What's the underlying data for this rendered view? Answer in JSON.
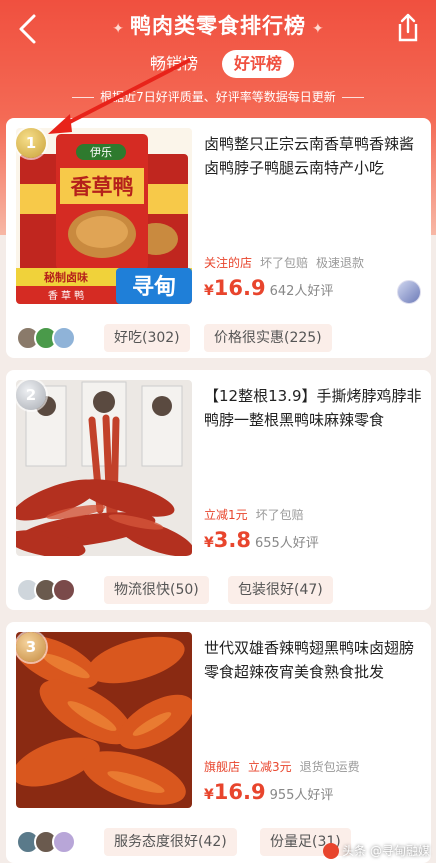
{
  "header": {
    "title": "鸭肉类零食排行榜",
    "tabs": [
      "畅销榜",
      "好评榜"
    ],
    "active_tab": "好评榜",
    "subtitle": "根据近7日好评质量、好评率等数据每日更新"
  },
  "products": [
    {
      "rank": "1",
      "title": "卤鸭整只正宗云南香草鸭香辣酱卤鸭脖子鸭腿云南特产小吃",
      "tags": [
        "关注的店",
        "坏了包赔",
        "极速退款"
      ],
      "price_symbol": "¥",
      "price": "16.9",
      "likes": "642人好评",
      "reviews": [
        "好吃(302)",
        "价格很实惠(225)"
      ],
      "image_label": "寻甸",
      "package_brand": "伊乐",
      "package_name": "香草鸭",
      "package_strip": "秘制卤味",
      "package_sub": "香 草 鸭"
    },
    {
      "rank": "2",
      "title": "【12整根13.9】手撕烤脖鸡脖非鸭脖一整根黑鸭味麻辣零食",
      "tags": [
        "立减1元",
        "坏了包赔"
      ],
      "price_symbol": "¥",
      "price": "3.8",
      "likes": "655人好评",
      "reviews": [
        "物流很快(50)",
        "包装很好(47)"
      ]
    },
    {
      "rank": "3",
      "title": "世代双雄香辣鸭翅黑鸭味卤翅膀零食超辣夜宵美食熟食批发",
      "tags": [
        "旗舰店",
        "立减3元",
        "退货包运费"
      ],
      "price_symbol": "¥",
      "price": "16.9",
      "likes": "955人好评",
      "reviews": [
        "服务态度很好(42)",
        "份量足(31)"
      ]
    }
  ],
  "watermark": "头条 @寻甸融媒",
  "colors": {
    "brand": "#f0503f",
    "price": "#e8452d"
  }
}
